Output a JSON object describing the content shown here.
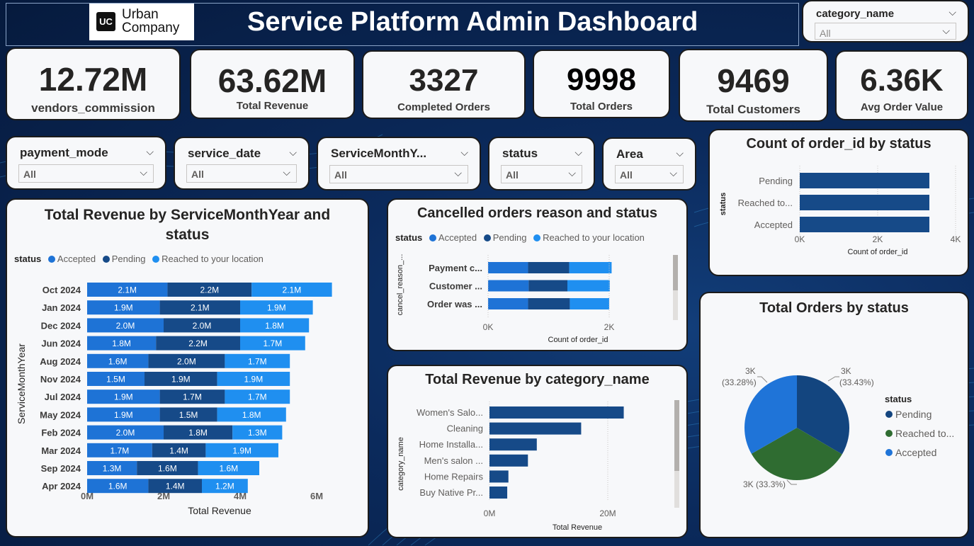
{
  "header": {
    "title": "Service Platform Admin Dashboard",
    "logo_text_1": "Urban",
    "logo_text_2": "Company",
    "logo_badge": "UC"
  },
  "category_slicer": {
    "label": "category_name",
    "value": "All"
  },
  "kpis": [
    {
      "value": "12.72M",
      "label": "vendors_commission"
    },
    {
      "value": "63.62M",
      "label": "Total Revenue"
    },
    {
      "value": "3327",
      "label": "Completed Orders"
    },
    {
      "value": "9998",
      "label": "Total Orders"
    },
    {
      "value": "9469",
      "label": "Total Customers"
    },
    {
      "value": "6.36K",
      "label": "Avg Order Value"
    }
  ],
  "slicers": [
    {
      "label": "payment_mode",
      "value": "All"
    },
    {
      "label": "service_date",
      "value": "All"
    },
    {
      "label": "ServiceMonthY...",
      "value": "All"
    },
    {
      "label": "status",
      "value": "All"
    },
    {
      "label": "Area",
      "value": "All"
    }
  ],
  "colors": {
    "accepted": "#1e73d6",
    "pending": "#164a88",
    "reached": "#1f8ff0",
    "pie_accepted": "#1f74d8",
    "pie_pending": "#13457f",
    "pie_reached": "#2f6c31"
  },
  "chart_data": [
    {
      "type": "bar",
      "orientation": "horizontal-stacked",
      "title": "Total Revenue by ServiceMonthYear and status",
      "legend_title": "status",
      "xlabel": "Total Revenue",
      "ylabel": "ServiceMonthYear",
      "xlim": [
        0,
        6
      ],
      "xticks": [
        "0M",
        "2M",
        "4M",
        "6M"
      ],
      "categories": [
        "Oct 2024",
        "Jan 2024",
        "Dec 2024",
        "Jun 2024",
        "Aug 2024",
        "Nov 2024",
        "Jul 2024",
        "May 2024",
        "Feb 2024",
        "Mar 2024",
        "Sep 2024",
        "Apr 2024"
      ],
      "series": [
        {
          "name": "Accepted",
          "values": [
            2.1,
            1.9,
            2.0,
            1.8,
            1.6,
            1.5,
            1.9,
            1.9,
            2.0,
            1.7,
            1.3,
            1.6
          ],
          "labels": [
            "2.1M",
            "1.9M",
            "2.0M",
            "1.8M",
            "1.6M",
            "1.5M",
            "1.9M",
            "1.9M",
            "2.0M",
            "1.7M",
            "1.3M",
            "1.6M"
          ]
        },
        {
          "name": "Pending",
          "values": [
            2.2,
            2.1,
            2.0,
            2.2,
            2.0,
            1.9,
            1.7,
            1.5,
            1.8,
            1.4,
            1.6,
            1.4
          ],
          "labels": [
            "2.2M",
            "2.1M",
            "2.0M",
            "2.2M",
            "2.0M",
            "1.9M",
            "1.7M",
            "1.5M",
            "1.8M",
            "1.4M",
            "1.6M",
            "1.4M"
          ]
        },
        {
          "name": "Reached to your location",
          "values": [
            2.1,
            1.9,
            1.8,
            1.7,
            1.7,
            1.9,
            1.7,
            1.8,
            1.3,
            1.9,
            1.6,
            1.2
          ],
          "labels": [
            "2.1M",
            "1.9M",
            "1.8M",
            "1.7M",
            "1.7M",
            "1.9M",
            "1.7M",
            "1.8M",
            "1.3M",
            "1.9M",
            "1.6M",
            "1.2M"
          ]
        }
      ]
    },
    {
      "type": "bar",
      "orientation": "horizontal-stacked",
      "title": "Cancelled orders reason and status",
      "legend_title": "status",
      "xlabel": "Count of order_id",
      "ylabel": "cancel_reason_...",
      "xlim": [
        0,
        2000
      ],
      "xticks": [
        "0K",
        "2K"
      ],
      "categories": [
        "Payment c...",
        "Customer ...",
        "Order was ..."
      ],
      "series": [
        {
          "name": "Accepted",
          "values": [
            660,
            670,
            660
          ]
        },
        {
          "name": "Pending",
          "values": [
            680,
            640,
            690
          ]
        },
        {
          "name": "Reached to your location",
          "values": [
            700,
            700,
            650
          ]
        }
      ]
    },
    {
      "type": "bar",
      "orientation": "horizontal",
      "title": "Count of order_id by status",
      "xlabel": "Count of order_id",
      "ylabel": "status",
      "xlim": [
        0,
        4000
      ],
      "xticks": [
        "0K",
        "2K",
        "4K"
      ],
      "categories": [
        "Pending",
        "Reached to...",
        "Accepted"
      ],
      "values": [
        3327,
        3327,
        3327
      ]
    },
    {
      "type": "bar",
      "orientation": "horizontal",
      "title": "Total Revenue by category_name",
      "xlabel": "Total Revenue",
      "ylabel": "category_name",
      "xlim": [
        0,
        25
      ],
      "xticks": [
        "0M",
        "20M"
      ],
      "categories": [
        "Women's Salo...",
        "Cleaning",
        "Home Installa...",
        "Men's salon ...",
        "Home Repairs",
        "Buy Native Pr..."
      ],
      "values": [
        22.7,
        15.5,
        8.0,
        6.5,
        3.2,
        3.0
      ]
    },
    {
      "type": "pie",
      "title": "Total Orders by status",
      "legend_title": "status",
      "labels": [
        "Pending",
        "Reached to...",
        "Accepted"
      ],
      "values": [
        3342,
        3327,
        3327
      ],
      "slice_labels": [
        "3K\n(33.43%)",
        "3K (33.3%)",
        "3K\n(33.28%)"
      ]
    }
  ]
}
